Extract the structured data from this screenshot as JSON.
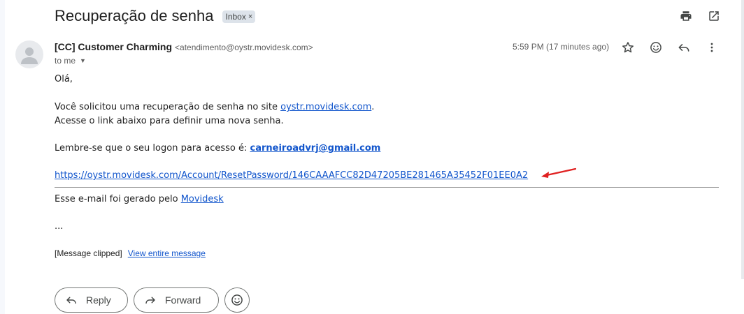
{
  "email": {
    "subject": "Recuperação de senha",
    "label": "Inbox",
    "label_remove": "×",
    "sender_name": "[CC] Customer Charming",
    "sender_email": "<atendimento@oystr.movidesk.com>",
    "recipient": "to me",
    "timestamp": "5:59 PM (17 minutes ago)"
  },
  "body": {
    "greeting": "Olá,",
    "line1_prefix": "Você solicitou uma recuperação de senha no site ",
    "line1_link": "oystr.movidesk.com",
    "line1_suffix": ".",
    "line2": "Acesse o link abaixo para definir uma nova senha.",
    "logon_prefix": "Lembre-se que o seu logon para acesso é: ",
    "logon_email": "carneiroadvrj@gmail.com",
    "reset_link": "https://oystr.movidesk.com/Account/ResetPassword/146CAAAFCC82D47205BE281465A35452F01EE0A2",
    "footer_prefix": "Esse e-mail foi gerado pelo ",
    "footer_link": "Movidesk",
    "ellipsis": "...",
    "clipped_text": "[Message clipped]",
    "view_entire": "View entire message"
  },
  "actions": {
    "reply": "Reply",
    "forward": "Forward"
  },
  "colors": {
    "link": "#1155cc",
    "annotation_arrow": "#e02020"
  },
  "icons": [
    "print-icon",
    "open-in-new-window-icon",
    "star-icon",
    "emoji-icon",
    "reply-icon",
    "more-vert-icon",
    "person-icon",
    "forward-icon",
    "caret-down-icon"
  ]
}
